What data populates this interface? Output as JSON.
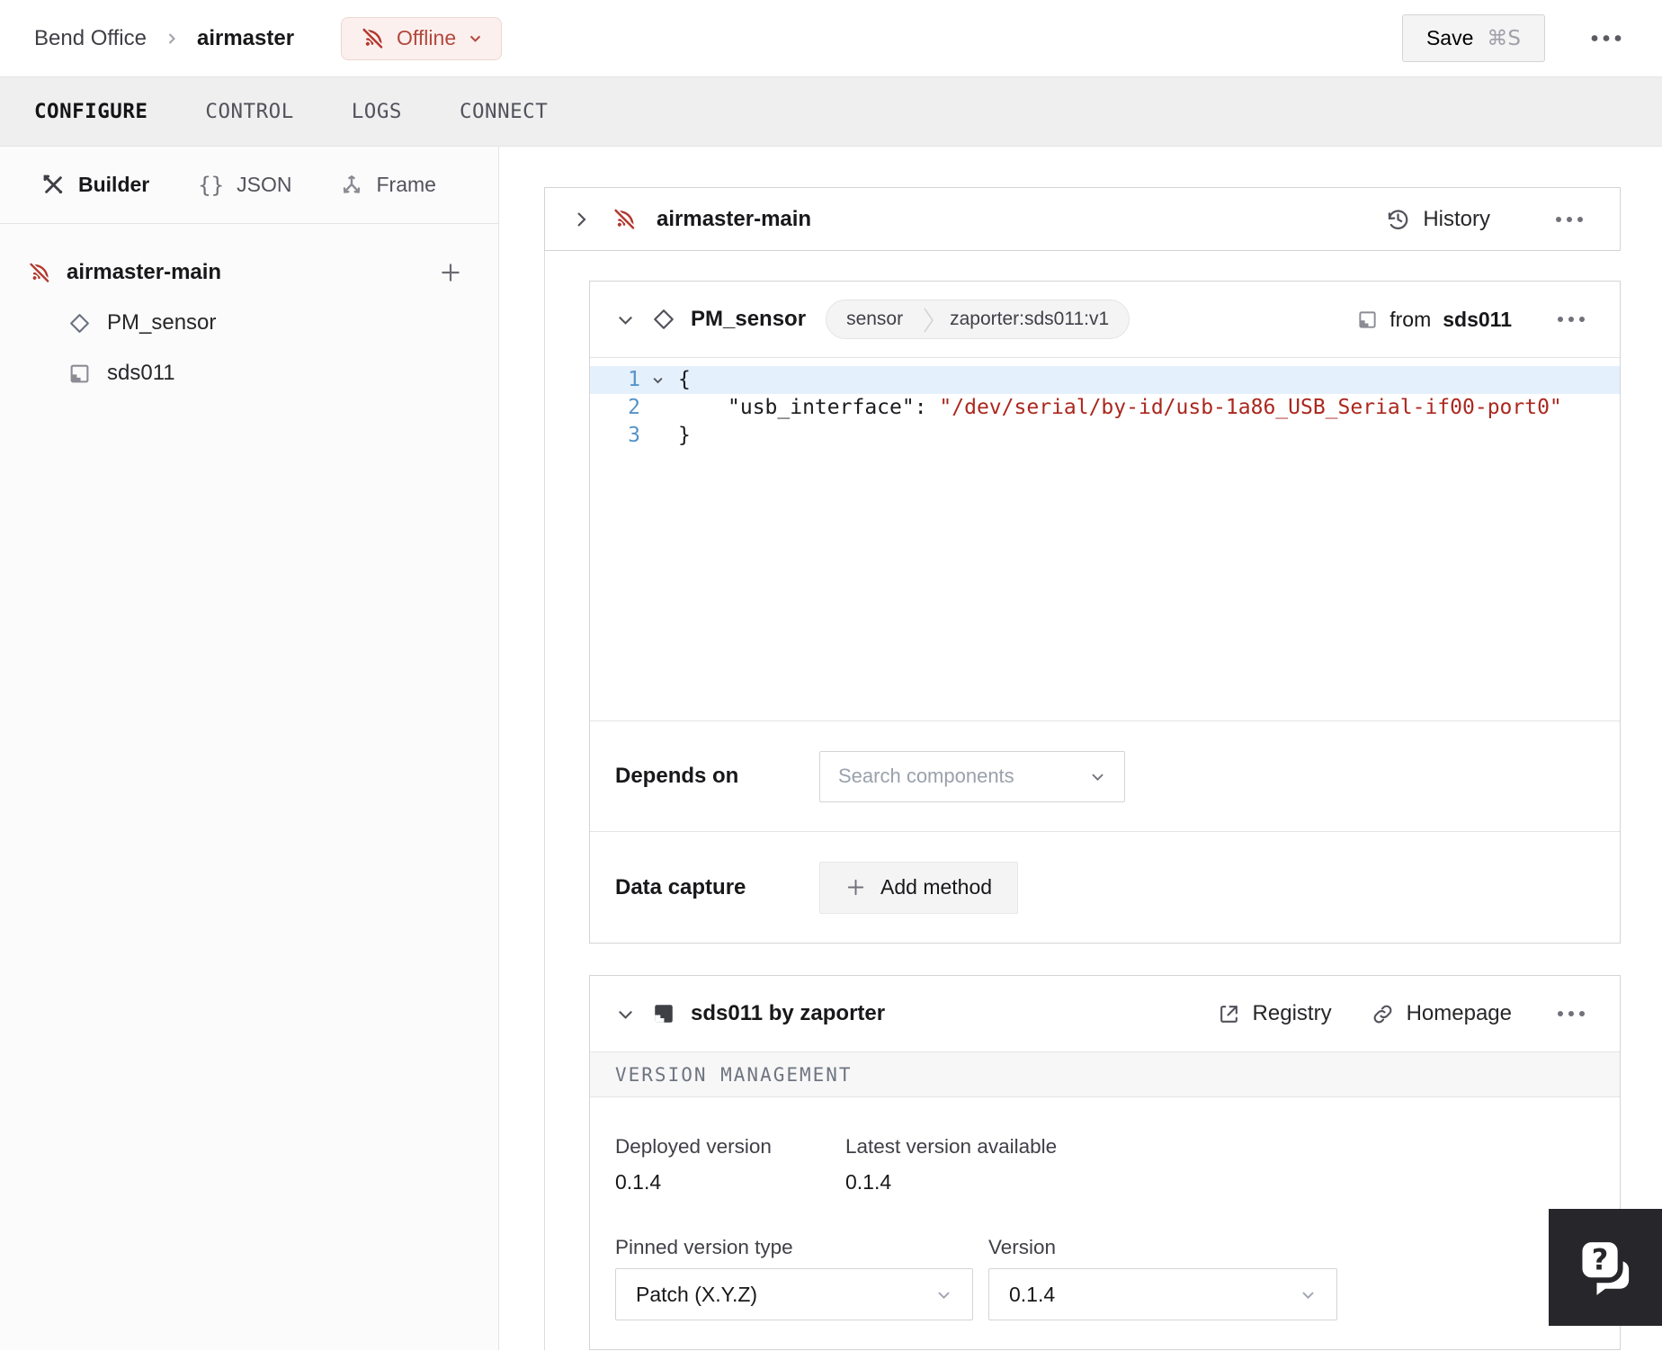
{
  "header": {
    "breadcrumb": {
      "org": "Bend Office",
      "machine": "airmaster"
    },
    "status": {
      "label": "Offline"
    },
    "save": {
      "label": "Save",
      "shortcut": "⌘S"
    }
  },
  "tabs": {
    "items": [
      {
        "label": "CONFIGURE",
        "active": true
      },
      {
        "label": "CONTROL",
        "active": false
      },
      {
        "label": "LOGS",
        "active": false
      },
      {
        "label": "CONNECT",
        "active": false
      }
    ]
  },
  "sidebar": {
    "modes": [
      {
        "label": "Builder",
        "icon": "tools-icon",
        "active": true
      },
      {
        "label": "JSON",
        "icon": "braces-icon",
        "active": false
      },
      {
        "label": "Frame",
        "icon": "frame-icon",
        "active": false
      }
    ],
    "braces_glyph": "{}",
    "tree": {
      "machine": {
        "label": "airmaster-main",
        "icon": "wifi-off-icon"
      },
      "children": [
        {
          "label": "PM_sensor",
          "icon": "diamond-icon"
        },
        {
          "label": "sds011",
          "icon": "module-icon"
        }
      ]
    }
  },
  "main": {
    "machine_card": {
      "title": "airmaster-main",
      "history_label": "History"
    },
    "component_card": {
      "title": "PM_sensor",
      "badge": {
        "type": "sensor",
        "model": "zaporter:sds011:v1"
      },
      "from": {
        "prefix": "from",
        "module": "sds011"
      },
      "editor": {
        "lines": [
          {
            "num": "1",
            "code": "{"
          },
          {
            "num": "2",
            "key": "\"usb_interface\"",
            "colon": ": ",
            "value": "\"/dev/serial/by-id/usb-1a86_USB_Serial-if00-port0\""
          },
          {
            "num": "3",
            "code": "}"
          }
        ]
      },
      "depends_on": {
        "label": "Depends on",
        "placeholder": "Search components"
      },
      "data_capture": {
        "label": "Data capture",
        "button": "Add method"
      }
    },
    "module_card": {
      "title": "sds011 by zaporter",
      "registry_label": "Registry",
      "homepage_label": "Homepage",
      "section_title": "VERSION MANAGEMENT",
      "deployed": {
        "label": "Deployed version",
        "value": "0.1.4"
      },
      "latest": {
        "label": "Latest version available",
        "value": "0.1.4"
      },
      "pinned": {
        "label": "Pinned version type",
        "value": "Patch (X.Y.Z)"
      },
      "version": {
        "label": "Version",
        "value": "0.1.4"
      }
    }
  },
  "icons": {
    "help_glyph": "?",
    "named": [
      "wifi-off-icon",
      "chevron-down-icon",
      "chevron-right-icon",
      "diamond-icon",
      "module-icon",
      "tools-icon",
      "braces-icon",
      "frame-icon",
      "plus-icon",
      "history-icon",
      "external-link-icon",
      "link-icon",
      "ellipsis-icon",
      "help-icon"
    ]
  },
  "colors": {
    "status_red": "#b2483d",
    "status_bg": "#fcf0ee",
    "code_string": "#ab271e",
    "line_number_blue": "#5593c8",
    "editor_highlight": "#e4f0fb",
    "tab_bar_bg": "#efeff0",
    "help_fab_bg": "#27272b"
  }
}
